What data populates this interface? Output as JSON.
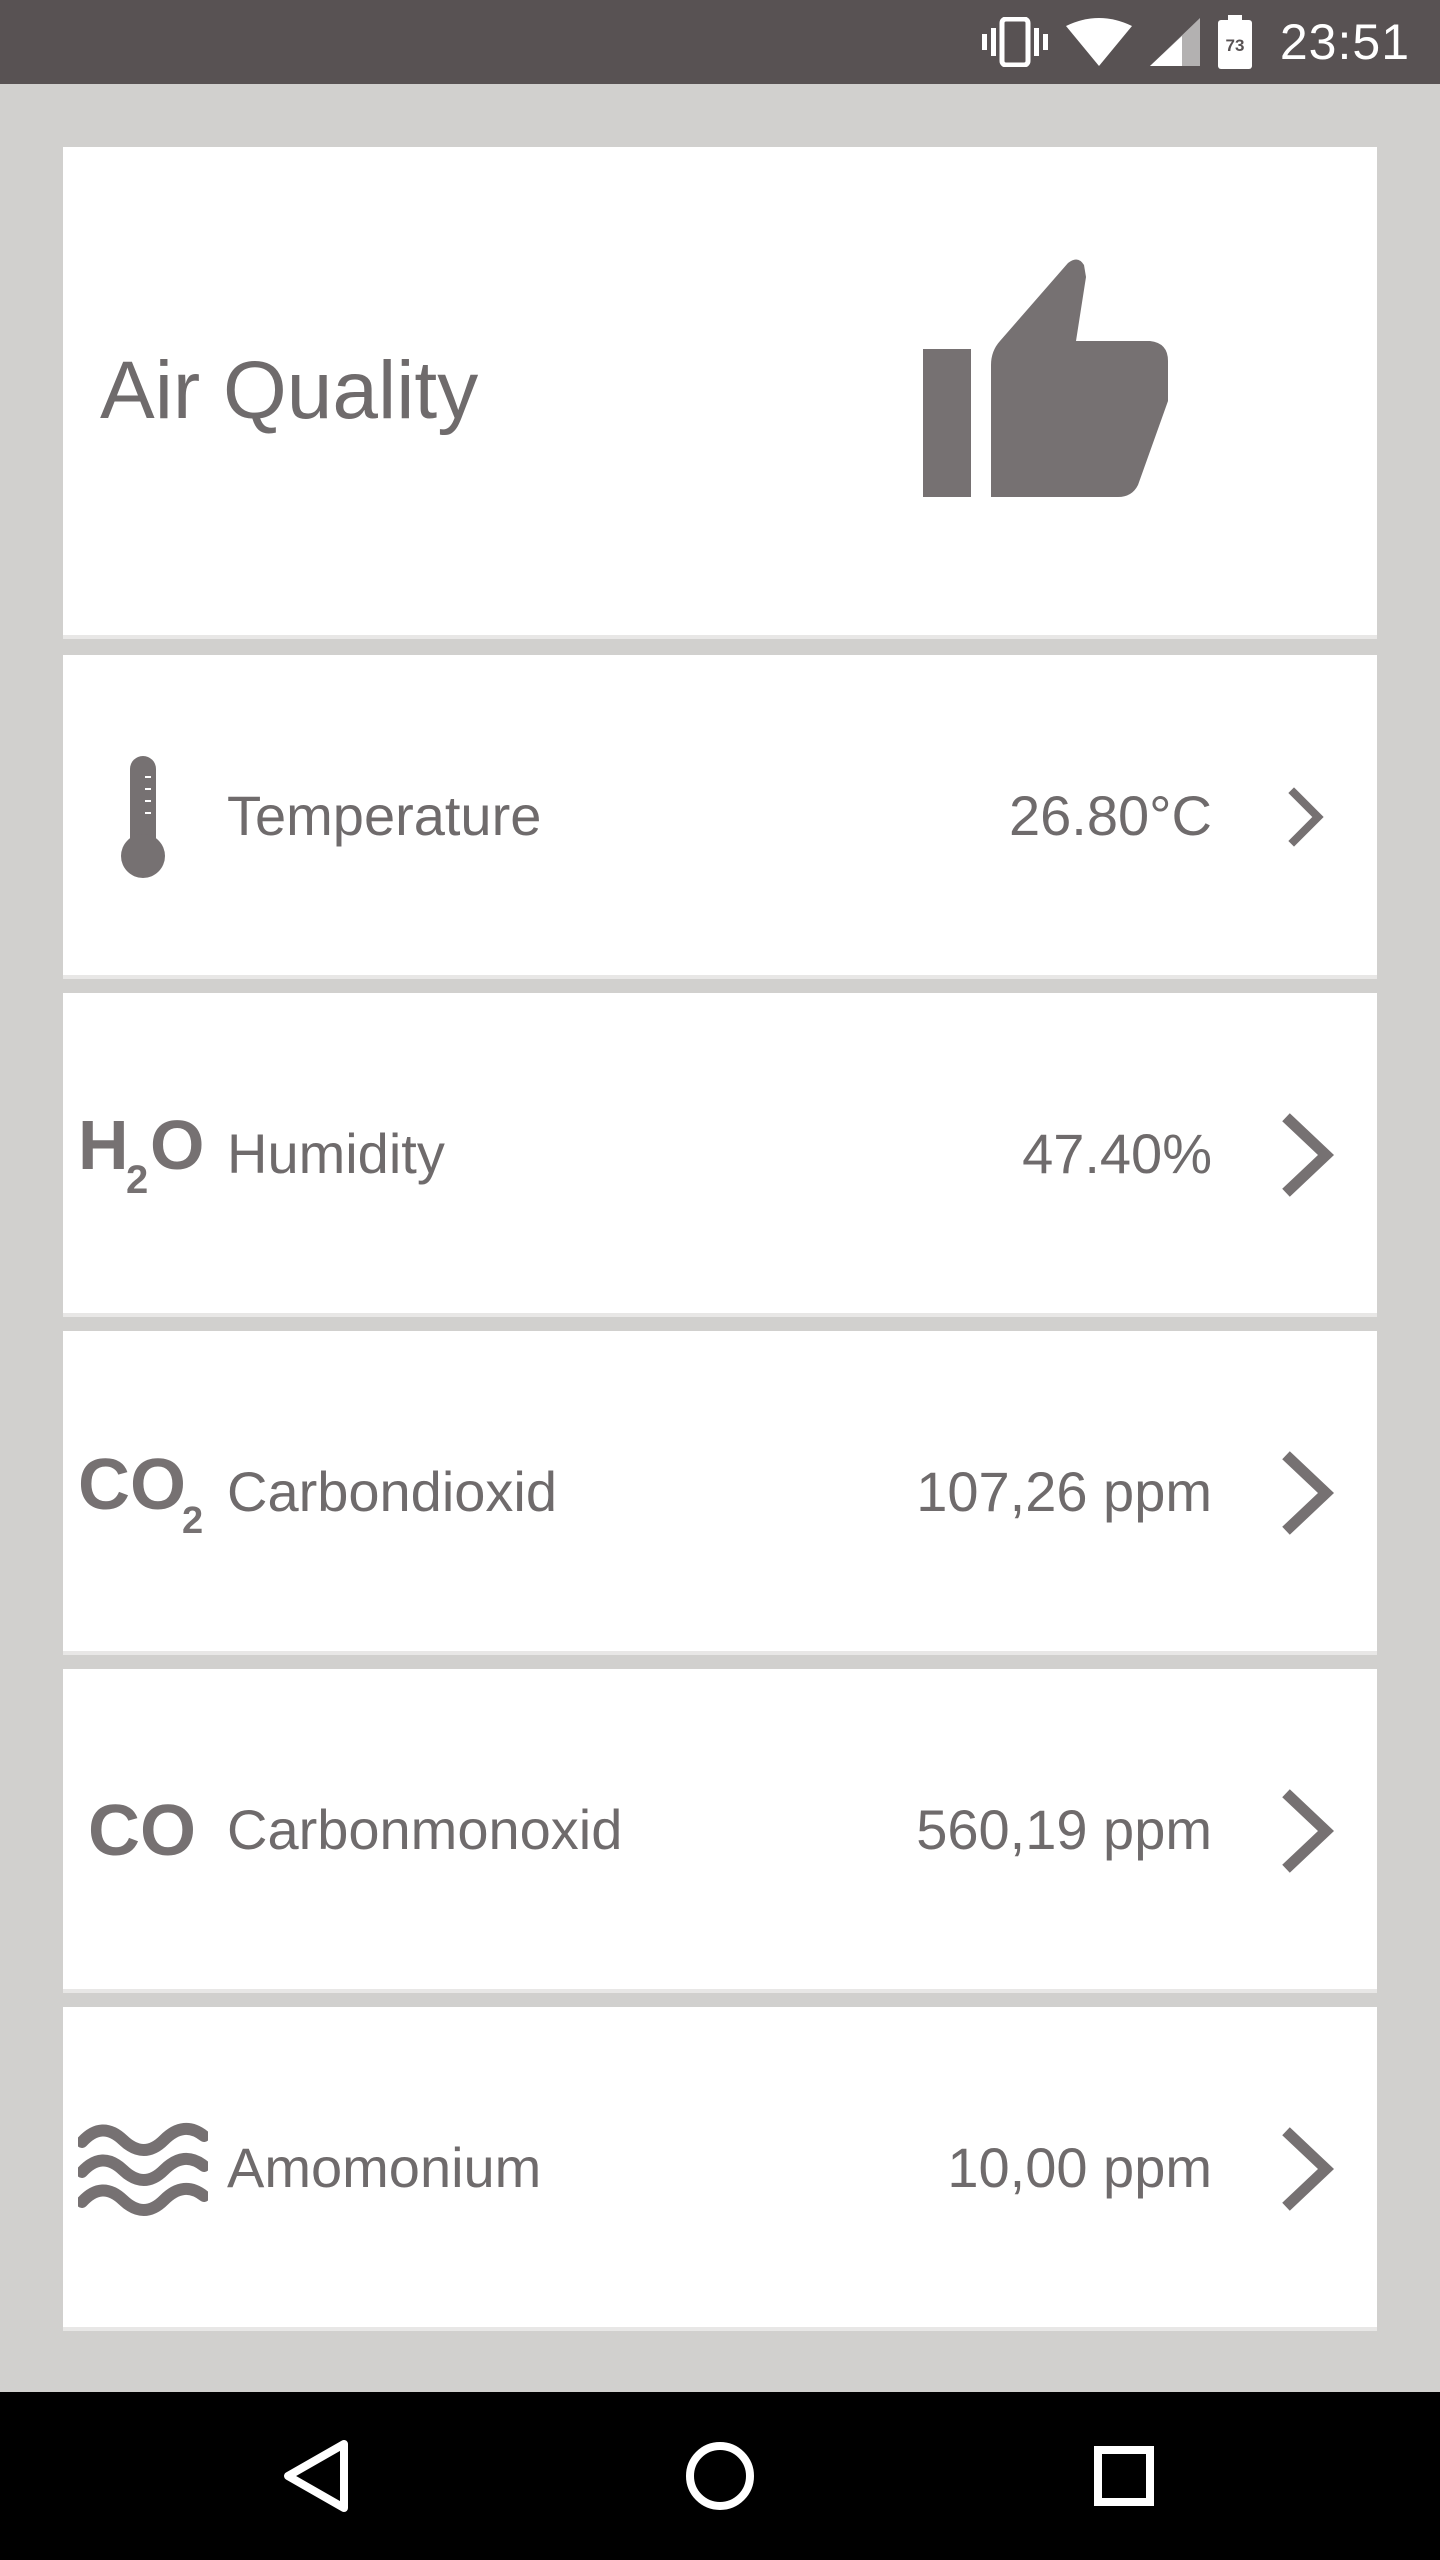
{
  "status_bar": {
    "time": "23:51",
    "battery_level": "73",
    "icons": [
      "vibrate-icon",
      "wifi-icon",
      "cell-signal-icon",
      "battery-icon"
    ]
  },
  "hero": {
    "title": "Air Quality",
    "icon": "thumbs-up-icon"
  },
  "sensors": [
    {
      "label": "Temperature",
      "value": "26.80°C",
      "icon": "thermometer-icon"
    },
    {
      "label": "Humidity",
      "value": "47.40%",
      "icon": "h2o-icon",
      "icon_text": "H2O"
    },
    {
      "label": "Carbondioxid",
      "value": "107,26 ppm",
      "icon": "co2-icon",
      "icon_text": "CO2"
    },
    {
      "label": "Carbonmonoxid",
      "value": "560,19 ppm",
      "icon": "co-icon",
      "icon_text": "CO"
    },
    {
      "label": "Amomonium",
      "value": "10,00 ppm",
      "icon": "waves-icon"
    }
  ],
  "nav_bar": {
    "buttons": [
      "back-icon",
      "home-icon",
      "recents-icon"
    ]
  },
  "colors": {
    "background": "#d1d0ce",
    "card": "#ffffff",
    "text": "#6f6b6c",
    "icon": "#767172",
    "status_bar": "#585253",
    "nav_bar": "#000000"
  }
}
